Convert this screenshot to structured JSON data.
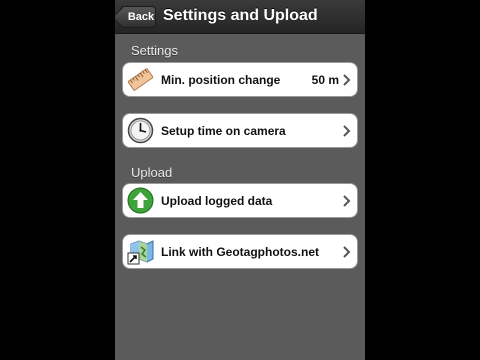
{
  "navbar": {
    "back_label": "Back",
    "title": "Settings and Upload"
  },
  "sections": {
    "settings": {
      "header": "Settings",
      "items": [
        {
          "label": "Min. position change",
          "value": "50 m",
          "icon": "ruler-icon"
        },
        {
          "label": "Setup time on camera",
          "value": "",
          "icon": "clock-icon"
        }
      ]
    },
    "upload": {
      "header": "Upload",
      "items": [
        {
          "label": "Upload logged data",
          "value": "",
          "icon": "upload-arrow-icon"
        },
        {
          "label": "Link with Geotagphotos.net",
          "value": "",
          "icon": "map-link-icon"
        }
      ]
    }
  },
  "colors": {
    "background": "#5b5b5b",
    "navbar": "#2e2e2e",
    "cell": "#ffffff",
    "upload_green": "#3ea33a"
  }
}
